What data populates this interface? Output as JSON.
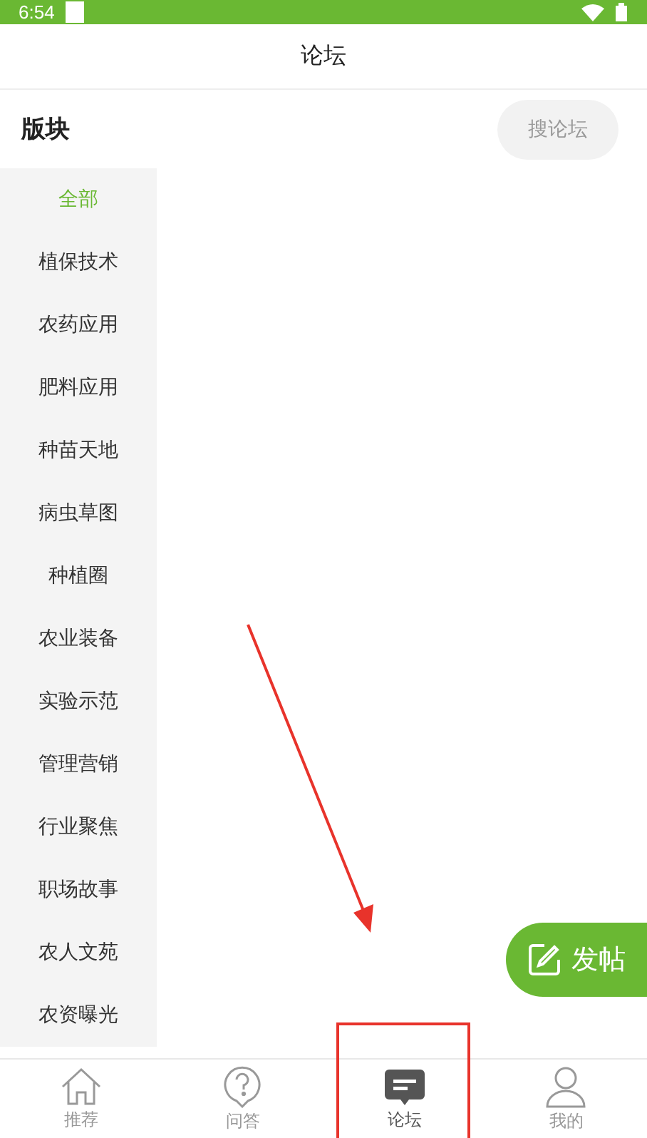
{
  "status_bar": {
    "time": "6:54"
  },
  "header": {
    "title": "论坛"
  },
  "section": {
    "title": "版块",
    "search_button": "搜论坛"
  },
  "categories": [
    {
      "label": "全部",
      "selected": true
    },
    {
      "label": "植保技术",
      "selected": false
    },
    {
      "label": "农药应用",
      "selected": false
    },
    {
      "label": "肥料应用",
      "selected": false
    },
    {
      "label": "种苗天地",
      "selected": false
    },
    {
      "label": "病虫草图",
      "selected": false
    },
    {
      "label": "种植圈",
      "selected": false
    },
    {
      "label": "农业装备",
      "selected": false
    },
    {
      "label": "实验示范",
      "selected": false
    },
    {
      "label": "管理营销",
      "selected": false
    },
    {
      "label": "行业聚焦",
      "selected": false
    },
    {
      "label": "职场故事",
      "selected": false
    },
    {
      "label": "农人文苑",
      "selected": false
    },
    {
      "label": "农资曝光",
      "selected": false
    }
  ],
  "post_button": {
    "label": "发帖"
  },
  "tab_bar": [
    {
      "kind": "home",
      "label": "推荐",
      "selected": false
    },
    {
      "kind": "question",
      "label": "问答",
      "selected": false
    },
    {
      "kind": "forum",
      "label": "论坛",
      "selected": true
    },
    {
      "kind": "profile",
      "label": "我的",
      "selected": false
    }
  ],
  "annotations": {
    "arrow": true,
    "highlight_box": true
  }
}
